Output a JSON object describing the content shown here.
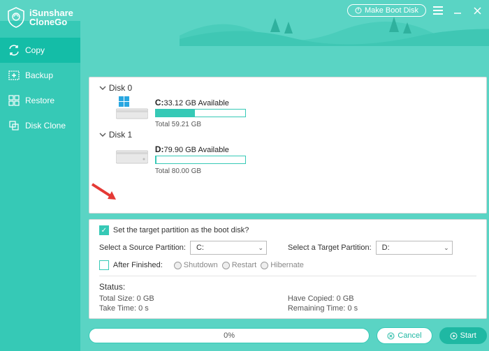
{
  "app": {
    "name1": "iSunshare",
    "name2": "CloneGo"
  },
  "titlebar": {
    "make_boot_disk": "Make Boot Disk"
  },
  "sidebar": {
    "items": [
      {
        "label": "Copy"
      },
      {
        "label": "Backup"
      },
      {
        "label": "Restore"
      },
      {
        "label": "Disk Clone"
      }
    ]
  },
  "disks": [
    {
      "header": "Disk 0",
      "drive": {
        "letter": "C:",
        "available": "33.12 GB Available",
        "total": "Total 59.21 GB",
        "fill_pct": 44
      }
    },
    {
      "header": "Disk 1",
      "drive": {
        "letter": "D:",
        "available": "79.90 GB Available",
        "total": "Total 80.00 GB",
        "fill_pct": 1
      }
    }
  ],
  "settings": {
    "boot_checkbox_label": "Set the target partition as the boot disk?",
    "source_label": "Select a Source Partition:",
    "source_value": "C:",
    "target_label": "Select a Target Partition:",
    "target_value": "D:",
    "after_label": "After Finished:",
    "radios": [
      "Shutdown",
      "Restart",
      "Hibernate"
    ]
  },
  "status": {
    "title": "Status:",
    "total_size": "Total Size: 0 GB",
    "have_copied": "Have Copied: 0 GB",
    "take_time": "Take Time: 0 s",
    "remaining_time": "Remaining Time: 0 s"
  },
  "footer": {
    "progress_text": "0%",
    "cancel": "Cancel",
    "start": "Start"
  }
}
